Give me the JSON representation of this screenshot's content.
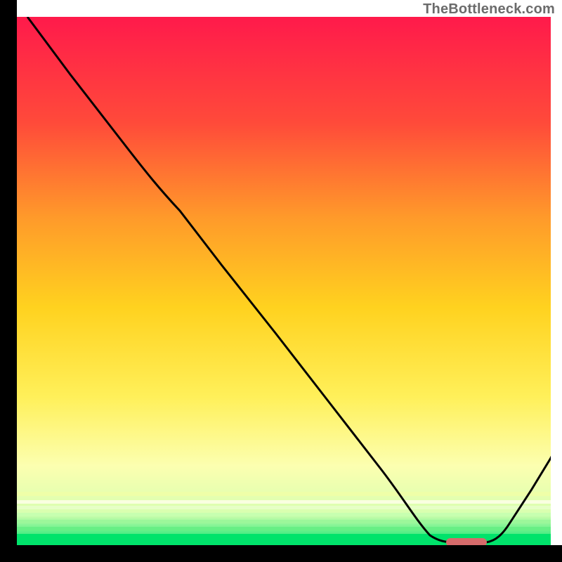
{
  "watermark": "TheBottleneck.com",
  "colors": {
    "gradient_top": "#ff1a4b",
    "gradient_mid_upper": "#ff7a2a",
    "gradient_mid": "#ffd21f",
    "gradient_mid_lower": "#fff176",
    "gradient_lower": "#f6ffbf",
    "gradient_bottom": "#00e36b",
    "curve": "#000000",
    "marker": "#d66b6b",
    "axis": "#000000"
  },
  "chart_data": {
    "type": "line",
    "title": "",
    "xlabel": "",
    "ylabel": "",
    "xlim": [
      0,
      100
    ],
    "ylim": [
      0,
      100
    ],
    "x": [
      2,
      10,
      20,
      27,
      35,
      45,
      55,
      65,
      72,
      75,
      80,
      85,
      90,
      95,
      100
    ],
    "values": [
      100,
      89,
      76,
      68,
      58,
      46,
      33,
      20,
      8,
      2,
      0,
      0,
      4,
      12,
      21
    ],
    "minimum_marker": {
      "x_start": 78,
      "x_end": 86,
      "y": 0
    },
    "notes": "Curve descends from top-left, flattens at bottom near x≈80, small marker pill at the trough, then rises toward bottom-right."
  }
}
